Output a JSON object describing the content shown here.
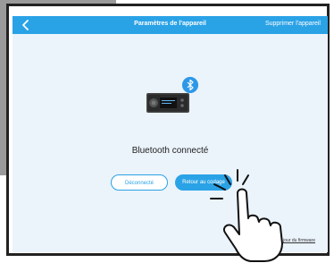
{
  "header": {
    "title": "Paramètres de l'appareil",
    "action_label": "Supprimer l'appareil",
    "back_icon": "chevron-left-icon"
  },
  "main": {
    "status_text": "Bluetooth connecté",
    "disconnect_label": "Déconnecté",
    "return_label": "Retour au codage",
    "firmware_link": "Aide à la mise à jour du firmware"
  },
  "colors": {
    "accent": "#2aa2e6",
    "background": "#ebf3fb",
    "backdrop": "#9a9a9a"
  }
}
